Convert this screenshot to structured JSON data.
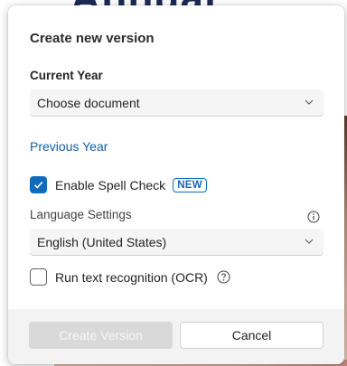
{
  "background": {
    "title_fragment": "Annual"
  },
  "dialog": {
    "title": "Create new version",
    "current_year": {
      "label": "Current Year",
      "selected": "Choose document"
    },
    "previous_year_link": "Previous Year",
    "spell_check": {
      "label": "Enable Spell Check",
      "checked": true,
      "badge": "NEW"
    },
    "language": {
      "label": "Language Settings",
      "selected": "English (United States)"
    },
    "ocr": {
      "label": "Run text recognition (OCR)",
      "checked": false
    },
    "footer": {
      "primary_label": "Create Version",
      "primary_enabled": false,
      "secondary_label": "Cancel"
    }
  },
  "colors": {
    "accent": "#0f6cbd",
    "link": "#115ea3",
    "disabled_button": "#d9d9d9"
  },
  "icons": [
    "chevron-down-icon",
    "checkmark-icon",
    "info-icon",
    "question-icon"
  ]
}
